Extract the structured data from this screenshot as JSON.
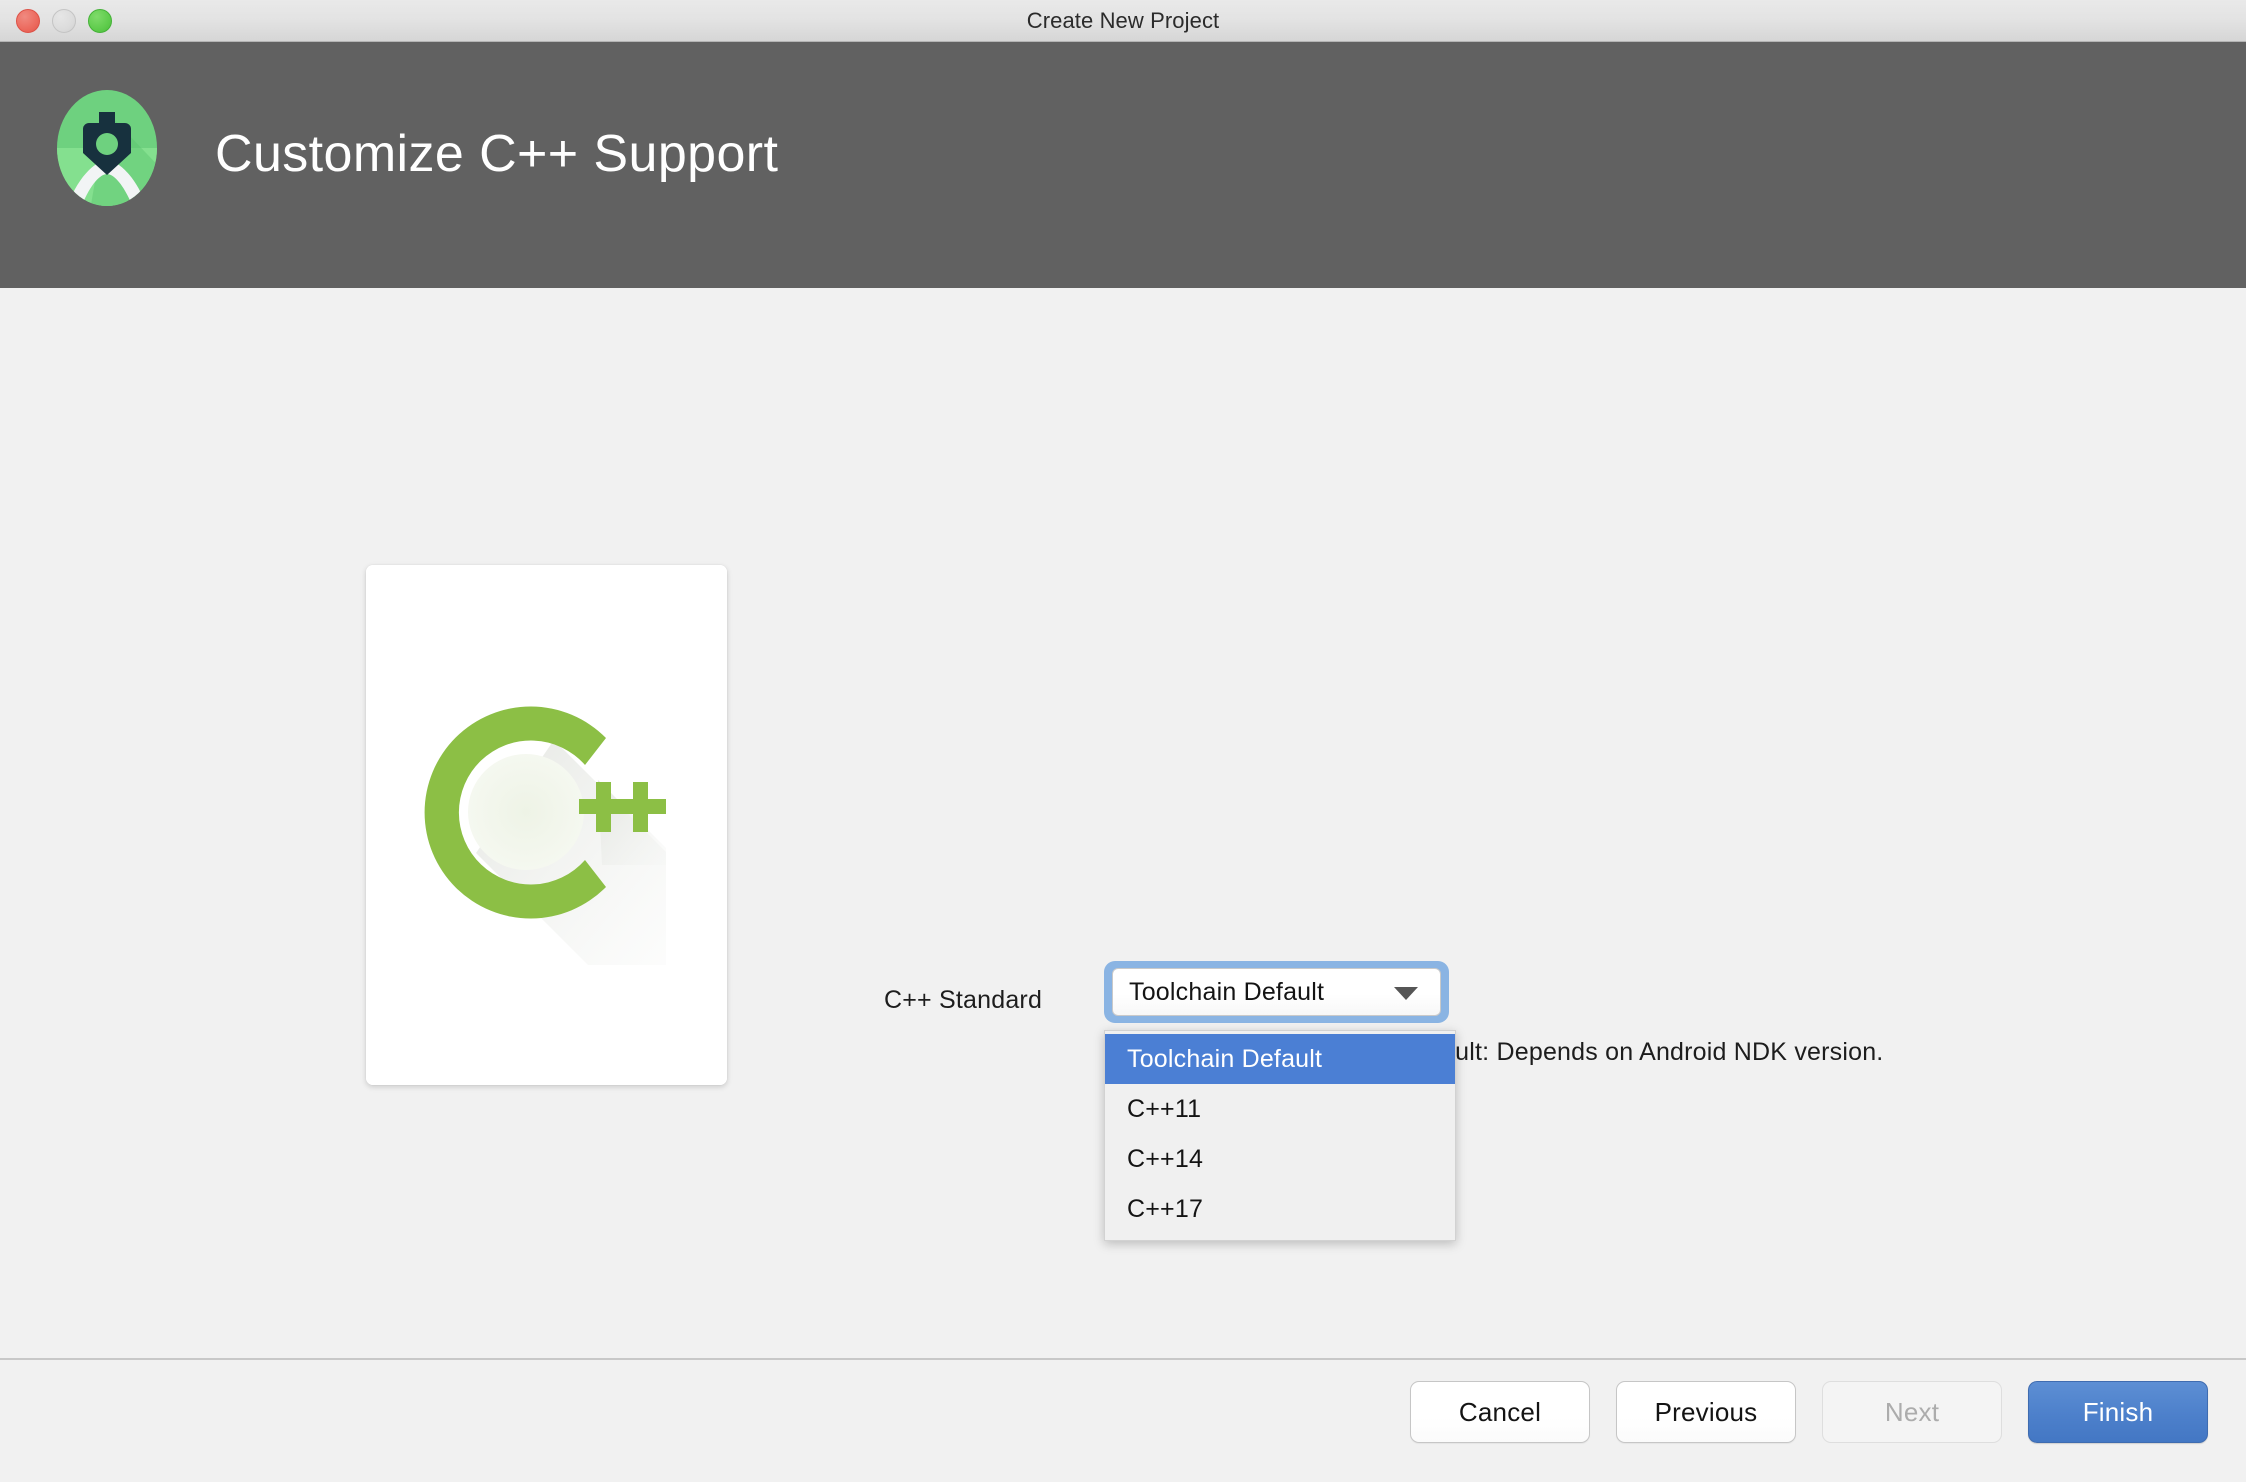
{
  "window": {
    "title": "Create New Project",
    "traffic_lights": {
      "close": "close-button",
      "minimize": "minimize-button",
      "maximize": "maximize-button"
    }
  },
  "header": {
    "title": "Customize C++ Support",
    "logo_name": "android-studio-logo",
    "background_color": "#616161",
    "title_color": "#ffffff"
  },
  "main": {
    "illustration": {
      "name": "cpp-illustration-card",
      "letter": "C",
      "plus": "++",
      "accent_color": "#8cbf45"
    },
    "form": {
      "label": "C++ Standard",
      "combobox": {
        "value": "Toolchain Default",
        "focus_ring_color": "#8ab4e3",
        "expanded": true
      },
      "hint": "Toolchain Default: Depends on Android NDK version.",
      "hint_visible_fragment": "pends on Android NDK version.",
      "options": [
        {
          "label": "Toolchain Default",
          "selected": true
        },
        {
          "label": "C++11",
          "selected": false
        },
        {
          "label": "C++14",
          "selected": false
        },
        {
          "label": "C++17",
          "selected": false
        }
      ],
      "selected_option_color": "#4b7fd4"
    }
  },
  "footer": {
    "buttons": [
      {
        "label": "Cancel",
        "state": "enabled",
        "style": "normal"
      },
      {
        "label": "Previous",
        "state": "enabled",
        "style": "normal"
      },
      {
        "label": "Next",
        "state": "disabled",
        "style": "disabled"
      },
      {
        "label": "Finish",
        "state": "enabled",
        "style": "primary"
      }
    ],
    "primary_color": "#4d80cb"
  }
}
